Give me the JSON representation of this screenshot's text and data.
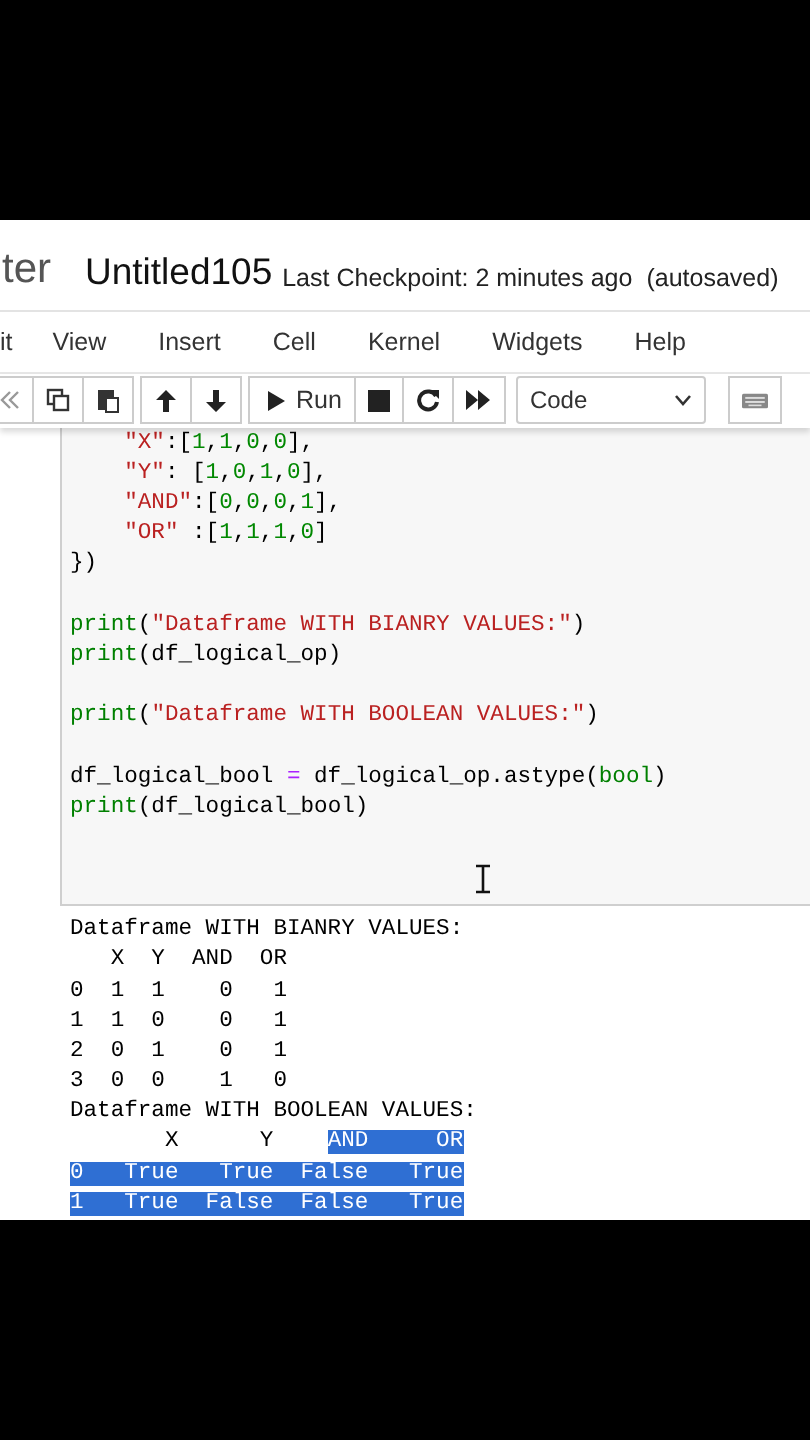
{
  "header": {
    "logo_text": "ter",
    "notebook_name": "Untitled105",
    "checkpoint": "Last Checkpoint: 2 minutes ago",
    "save_status": "(autosaved)"
  },
  "menu": [
    "it",
    "View",
    "Insert",
    "Cell",
    "Kernel",
    "Widgets",
    "Help"
  ],
  "toolbar": {
    "run_label": "Run",
    "cell_type": "Code"
  },
  "code_cell": {
    "lines": [
      {
        "indented": true,
        "space_before": false,
        "segments": [
          {
            "text": "\"X\"",
            "kind": "str"
          },
          {
            "text": ":[",
            "kind": "plain"
          },
          {
            "text": "1",
            "kind": "num"
          },
          {
            "text": ",",
            "kind": "plain"
          },
          {
            "text": "1",
            "kind": "num"
          },
          {
            "text": ",",
            "kind": "plain"
          },
          {
            "text": "0",
            "kind": "num"
          },
          {
            "text": ",",
            "kind": "plain"
          },
          {
            "text": "0",
            "kind": "num"
          },
          {
            "text": "],",
            "kind": "plain"
          }
        ]
      },
      {
        "indented": true,
        "space_before": false,
        "segments": [
          {
            "text": "\"Y\"",
            "kind": "str"
          },
          {
            "text": ": [",
            "kind": "plain"
          },
          {
            "text": "1",
            "kind": "num"
          },
          {
            "text": ",",
            "kind": "plain"
          },
          {
            "text": "0",
            "kind": "num"
          },
          {
            "text": ",",
            "kind": "plain"
          },
          {
            "text": "1",
            "kind": "num"
          },
          {
            "text": ",",
            "kind": "plain"
          },
          {
            "text": "0",
            "kind": "num"
          },
          {
            "text": "],",
            "kind": "plain"
          }
        ]
      },
      {
        "indented": true,
        "space_before": false,
        "segments": [
          {
            "text": "\"AND\"",
            "kind": "str"
          },
          {
            "text": ":[",
            "kind": "plain"
          },
          {
            "text": "0",
            "kind": "num"
          },
          {
            "text": ",",
            "kind": "plain"
          },
          {
            "text": "0",
            "kind": "num"
          },
          {
            "text": ",",
            "kind": "plain"
          },
          {
            "text": "0",
            "kind": "num"
          },
          {
            "text": ",",
            "kind": "plain"
          },
          {
            "text": "1",
            "kind": "num"
          },
          {
            "text": "],",
            "kind": "plain"
          }
        ]
      },
      {
        "indented": true,
        "space_before": false,
        "segments": [
          {
            "text": "\"OR\"",
            "kind": "str"
          },
          {
            "text": " :[",
            "kind": "plain"
          },
          {
            "text": "1",
            "kind": "num"
          },
          {
            "text": ",",
            "kind": "plain"
          },
          {
            "text": "1",
            "kind": "num"
          },
          {
            "text": ",",
            "kind": "plain"
          },
          {
            "text": "1",
            "kind": "num"
          },
          {
            "text": ",",
            "kind": "plain"
          },
          {
            "text": "0",
            "kind": "num"
          },
          {
            "text": "]",
            "kind": "plain"
          }
        ]
      },
      {
        "indented": false,
        "space_before": false,
        "segments": [
          {
            "text": "})",
            "kind": "plain"
          }
        ]
      },
      {
        "indented": false,
        "space_before": true,
        "segments": [
          {
            "text": "print",
            "kind": "kw"
          },
          {
            "text": "(",
            "kind": "plain"
          },
          {
            "text": "\"Dataframe WITH BIANRY VALUES:\"",
            "kind": "str"
          },
          {
            "text": ")",
            "kind": "plain"
          }
        ]
      },
      {
        "indented": false,
        "space_before": false,
        "segments": [
          {
            "text": "print",
            "kind": "kw"
          },
          {
            "text": "(df_logical_op)",
            "kind": "plain"
          }
        ]
      },
      {
        "indented": false,
        "space_before": true,
        "segments": [
          {
            "text": "print",
            "kind": "kw"
          },
          {
            "text": "(",
            "kind": "plain"
          },
          {
            "text": "\"Dataframe WITH BOOLEAN VALUES:\"",
            "kind": "str"
          },
          {
            "text": ")",
            "kind": "plain"
          }
        ]
      },
      {
        "indented": false,
        "space_before": true,
        "segments": [
          {
            "text": "df_logical_bool ",
            "kind": "plain"
          },
          {
            "text": "=",
            "kind": "op"
          },
          {
            "text": " df_logical_op.astype(",
            "kind": "plain"
          },
          {
            "text": "bool",
            "kind": "kw"
          },
          {
            "text": ")",
            "kind": "plain"
          }
        ]
      },
      {
        "indented": false,
        "space_before": false,
        "segments": [
          {
            "text": "print",
            "kind": "kw"
          },
          {
            "text": "(df_logical_bool)",
            "kind": "plain"
          }
        ]
      }
    ]
  },
  "output": {
    "lines": [
      {
        "segments": [
          {
            "text": "Dataframe WITH BIANRY VALUES:",
            "selected": false
          }
        ]
      },
      {
        "segments": [
          {
            "text": "   X  Y  AND  OR",
            "selected": false
          }
        ]
      },
      {
        "segments": [
          {
            "text": "0  1  1    0   1",
            "selected": false
          }
        ]
      },
      {
        "segments": [
          {
            "text": "1  1  0    0   1",
            "selected": false
          }
        ]
      },
      {
        "segments": [
          {
            "text": "2  0  1    0   1",
            "selected": false
          }
        ]
      },
      {
        "segments": [
          {
            "text": "3  0  0    1   0",
            "selected": false
          }
        ]
      },
      {
        "segments": [
          {
            "text": "Dataframe WITH BOOLEAN VALUES:",
            "selected": false
          }
        ]
      },
      {
        "segments": [
          {
            "text": "       X      Y    ",
            "selected": false
          },
          {
            "text": "AND     OR",
            "selected": true
          }
        ]
      },
      {
        "segments": [
          {
            "text": "0   True   True  False   True",
            "selected": true
          }
        ]
      },
      {
        "segments": [
          {
            "text": "1   True  False  False   True",
            "selected": true
          }
        ]
      }
    ]
  }
}
